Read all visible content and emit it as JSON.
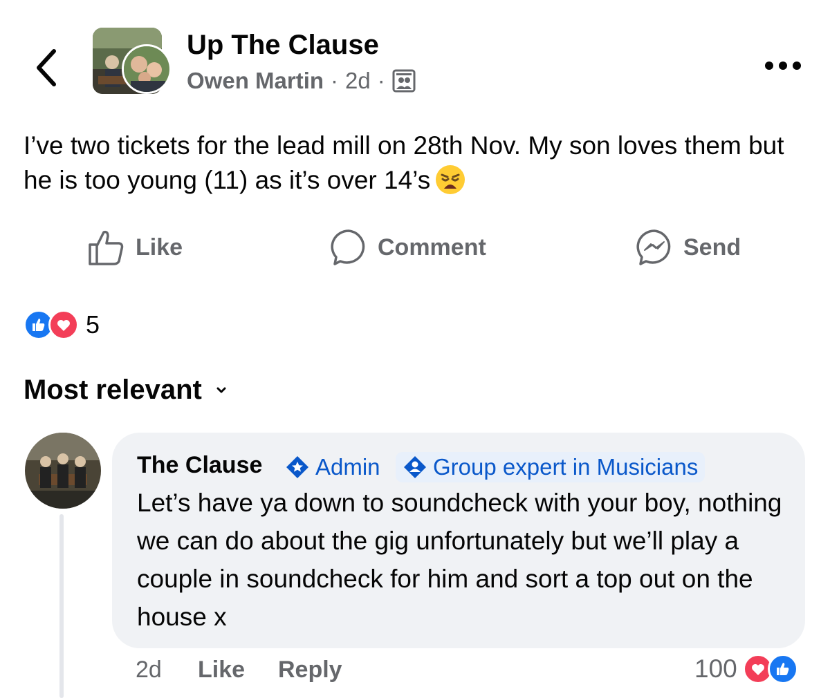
{
  "header": {
    "group_name": "Up The Clause",
    "author": "Owen Martin",
    "separator": "·",
    "time": "2d"
  },
  "post": {
    "text": "I’ve two tickets for the lead mill on 28th Nov. My son loves them but he is too young (11) as it’s over 14’s",
    "emoji": "weary-face"
  },
  "actions": {
    "like": "Like",
    "comment": "Comment",
    "send": "Send"
  },
  "reactions": {
    "count": "5",
    "types": [
      "like",
      "love"
    ]
  },
  "sort": {
    "label": "Most relevant"
  },
  "comment": {
    "name": "The Clause",
    "badge_admin": "Admin",
    "badge_expert": "Group expert in Musicians",
    "text": "Let’s have ya down to soundcheck with your boy, nothing we can do about the gig unfortunately but we’ll play a couple in soundcheck for him and sort a top out on the house x",
    "time": "2d",
    "like": "Like",
    "reply": "Reply",
    "reaction_count": "100"
  },
  "colors": {
    "primary_text": "#050505",
    "secondary_text": "#65676b",
    "link_blue": "#0a58ca",
    "like_blue": "#1877f2",
    "love_red": "#f33e58",
    "bubble_bg": "#f0f2f5"
  }
}
